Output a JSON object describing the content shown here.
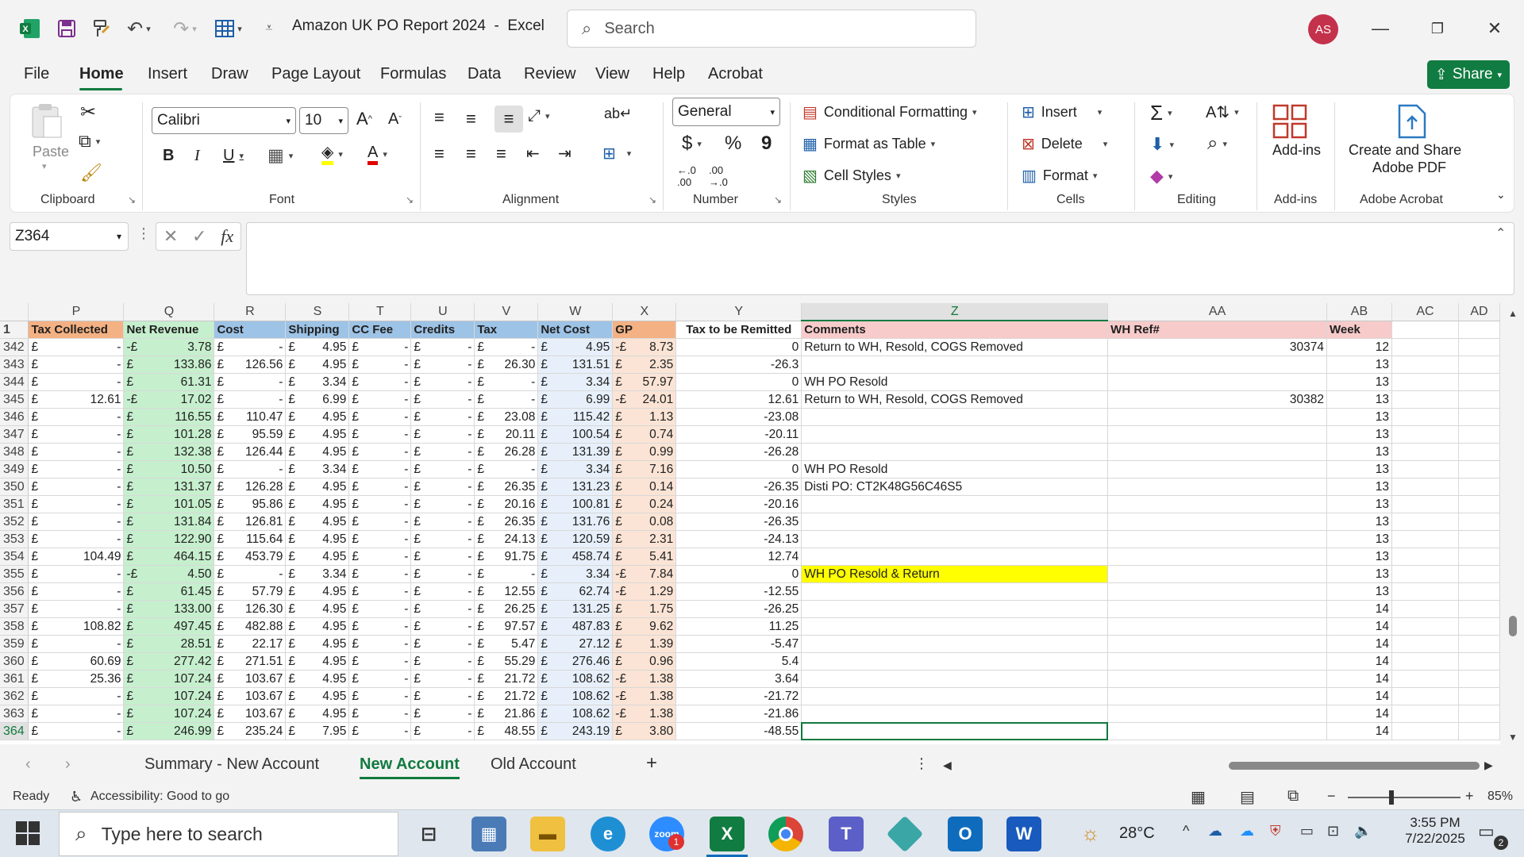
{
  "app": {
    "title": "Amazon UK PO Report 2024",
    "app_name": "Excel",
    "separator": "-",
    "user_initials": "AS"
  },
  "search": {
    "placeholder": "Search"
  },
  "menu": {
    "tabs": [
      "File",
      "Home",
      "Insert",
      "Draw",
      "Page Layout",
      "Formulas",
      "Data",
      "Review",
      "View",
      "Help",
      "Acrobat"
    ],
    "active": "Home",
    "share_label": "Share"
  },
  "ribbon": {
    "clipboard": {
      "label": "Clipboard",
      "paste": "Paste"
    },
    "font": {
      "label": "Font",
      "name": "Calibri",
      "size": "10"
    },
    "alignment": {
      "label": "Alignment"
    },
    "number": {
      "label": "Number",
      "format": "General",
      "currency": "$",
      "percent": "%",
      "comma": "9"
    },
    "styles": {
      "label": "Styles",
      "conditional": "Conditional Formatting",
      "table": "Format as Table",
      "cell": "Cell Styles"
    },
    "cells": {
      "label": "Cells",
      "insert": "Insert",
      "delete": "Delete",
      "format": "Format"
    },
    "editing": {
      "label": "Editing"
    },
    "addins": {
      "label": "Add-ins",
      "button": "Add-ins"
    },
    "acrobat": {
      "label": "Adobe Acrobat",
      "line1": "Create and Share",
      "line2": "Adobe PDF"
    }
  },
  "formula_bar": {
    "name_box": "Z364",
    "fx": "fx",
    "value": ""
  },
  "colors": {
    "accent": "#107c41",
    "header_orange": "#f4b183",
    "green": "#c6efce",
    "blue": "#9dc3e6",
    "pink": "#f8cbcb",
    "highlight": "#ffff00"
  },
  "columns": [
    "P",
    "Q",
    "R",
    "S",
    "T",
    "U",
    "V",
    "W",
    "X",
    "Y",
    "Z",
    "AA",
    "AB",
    "AC",
    "AD"
  ],
  "selected_column": "Z",
  "header_row_num": "1",
  "headers": [
    "Tax Collected",
    "Net Revenue",
    "Cost",
    "Shipping",
    "CC Fee",
    "Credits",
    "Tax",
    "Net Cost",
    "GP",
    "Tax to be Remitted",
    "Comments",
    "WH Ref#",
    "Week",
    "",
    ""
  ],
  "currency_symbol": "£",
  "rows": [
    {
      "n": "342",
      "p": "-",
      "qs": "-£",
      "q": "3.78",
      "r": "-",
      "s": "4.95",
      "t": "-",
      "u": "-",
      "v": "-",
      "w": "4.95",
      "xs": "-£",
      "x": "8.73",
      "y": "0",
      "z": "Return to WH, Resold, COGS Removed",
      "aa": "30374",
      "ab": "12"
    },
    {
      "n": "343",
      "p": "-",
      "qs": "£",
      "q": "133.86",
      "r": "126.56",
      "s": "4.95",
      "t": "-",
      "u": "-",
      "v": "26.30",
      "w": "131.51",
      "xs": "£",
      "x": "2.35",
      "y": "-26.3",
      "z": "",
      "aa": "",
      "ab": "13"
    },
    {
      "n": "344",
      "p": "-",
      "qs": "£",
      "q": "61.31",
      "r": "-",
      "s": "3.34",
      "t": "-",
      "u": "-",
      "v": "-",
      "w": "3.34",
      "xs": "£",
      "x": "57.97",
      "y": "0",
      "z": "WH PO Resold",
      "aa": "",
      "ab": "13"
    },
    {
      "n": "345",
      "p": "12.61",
      "qs": "-£",
      "q": "17.02",
      "r": "-",
      "s": "6.99",
      "t": "-",
      "u": "-",
      "v": "-",
      "w": "6.99",
      "xs": "-£",
      "x": "24.01",
      "y": "12.61",
      "z": "Return to WH, Resold, COGS Removed",
      "aa": "30382",
      "ab": "13"
    },
    {
      "n": "346",
      "p": "-",
      "qs": "£",
      "q": "116.55",
      "r": "110.47",
      "s": "4.95",
      "t": "-",
      "u": "-",
      "v": "23.08",
      "w": "115.42",
      "xs": "£",
      "x": "1.13",
      "y": "-23.08",
      "z": "",
      "aa": "",
      "ab": "13"
    },
    {
      "n": "347",
      "p": "-",
      "qs": "£",
      "q": "101.28",
      "r": "95.59",
      "s": "4.95",
      "t": "-",
      "u": "-",
      "v": "20.11",
      "w": "100.54",
      "xs": "£",
      "x": "0.74",
      "y": "-20.11",
      "z": "",
      "aa": "",
      "ab": "13"
    },
    {
      "n": "348",
      "p": "-",
      "qs": "£",
      "q": "132.38",
      "r": "126.44",
      "s": "4.95",
      "t": "-",
      "u": "-",
      "v": "26.28",
      "w": "131.39",
      "xs": "£",
      "x": "0.99",
      "y": "-26.28",
      "z": "",
      "aa": "",
      "ab": "13"
    },
    {
      "n": "349",
      "p": "-",
      "qs": "£",
      "q": "10.50",
      "r": "-",
      "s": "3.34",
      "t": "-",
      "u": "-",
      "v": "-",
      "w": "3.34",
      "xs": "£",
      "x": "7.16",
      "y": "0",
      "z": "WH PO Resold",
      "aa": "",
      "ab": "13"
    },
    {
      "n": "350",
      "p": "-",
      "qs": "£",
      "q": "131.37",
      "r": "126.28",
      "s": "4.95",
      "t": "-",
      "u": "-",
      "v": "26.35",
      "w": "131.23",
      "xs": "£",
      "x": "0.14",
      "y": "-26.35",
      "z": "Disti PO: CT2K48G56C46S5",
      "aa": "",
      "ab": "13"
    },
    {
      "n": "351",
      "p": "-",
      "qs": "£",
      "q": "101.05",
      "r": "95.86",
      "s": "4.95",
      "t": "-",
      "u": "-",
      "v": "20.16",
      "w": "100.81",
      "xs": "£",
      "x": "0.24",
      "y": "-20.16",
      "z": "",
      "aa": "",
      "ab": "13"
    },
    {
      "n": "352",
      "p": "-",
      "qs": "£",
      "q": "131.84",
      "r": "126.81",
      "s": "4.95",
      "t": "-",
      "u": "-",
      "v": "26.35",
      "w": "131.76",
      "xs": "£",
      "x": "0.08",
      "y": "-26.35",
      "z": "",
      "aa": "",
      "ab": "13"
    },
    {
      "n": "353",
      "p": "-",
      "qs": "£",
      "q": "122.90",
      "r": "115.64",
      "s": "4.95",
      "t": "-",
      "u": "-",
      "v": "24.13",
      "w": "120.59",
      "xs": "£",
      "x": "2.31",
      "y": "-24.13",
      "z": "",
      "aa": "",
      "ab": "13"
    },
    {
      "n": "354",
      "p": "104.49",
      "qs": "£",
      "q": "464.15",
      "r": "453.79",
      "s": "4.95",
      "t": "-",
      "u": "-",
      "v": "91.75",
      "w": "458.74",
      "xs": "£",
      "x": "5.41",
      "y": "12.74",
      "z": "",
      "aa": "",
      "ab": "13"
    },
    {
      "n": "355",
      "p": "-",
      "qs": "-£",
      "q": "4.50",
      "r": "-",
      "s": "3.34",
      "t": "-",
      "u": "-",
      "v": "-",
      "w": "3.34",
      "xs": "-£",
      "x": "7.84",
      "y": "0",
      "z": "WH PO Resold & Return",
      "aa": "",
      "ab": "13",
      "hl": true
    },
    {
      "n": "356",
      "p": "-",
      "qs": "£",
      "q": "61.45",
      "r": "57.79",
      "s": "4.95",
      "t": "-",
      "u": "-",
      "v": "12.55",
      "w": "62.74",
      "xs": "-£",
      "x": "1.29",
      "y": "-12.55",
      "z": "",
      "aa": "",
      "ab": "13"
    },
    {
      "n": "357",
      "p": "-",
      "qs": "£",
      "q": "133.00",
      "r": "126.30",
      "s": "4.95",
      "t": "-",
      "u": "-",
      "v": "26.25",
      "w": "131.25",
      "xs": "£",
      "x": "1.75",
      "y": "-26.25",
      "z": "",
      "aa": "",
      "ab": "14"
    },
    {
      "n": "358",
      "p": "108.82",
      "qs": "£",
      "q": "497.45",
      "r": "482.88",
      "s": "4.95",
      "t": "-",
      "u": "-",
      "v": "97.57",
      "w": "487.83",
      "xs": "£",
      "x": "9.62",
      "y": "11.25",
      "z": "",
      "aa": "",
      "ab": "14"
    },
    {
      "n": "359",
      "p": "-",
      "qs": "£",
      "q": "28.51",
      "r": "22.17",
      "s": "4.95",
      "t": "-",
      "u": "-",
      "v": "5.47",
      "w": "27.12",
      "xs": "£",
      "x": "1.39",
      "y": "-5.47",
      "z": "",
      "aa": "",
      "ab": "14"
    },
    {
      "n": "360",
      "p": "60.69",
      "qs": "£",
      "q": "277.42",
      "r": "271.51",
      "s": "4.95",
      "t": "-",
      "u": "-",
      "v": "55.29",
      "w": "276.46",
      "xs": "£",
      "x": "0.96",
      "y": "5.4",
      "z": "",
      "aa": "",
      "ab": "14"
    },
    {
      "n": "361",
      "p": "25.36",
      "qs": "£",
      "q": "107.24",
      "r": "103.67",
      "s": "4.95",
      "t": "-",
      "u": "-",
      "v": "21.72",
      "w": "108.62",
      "xs": "-£",
      "x": "1.38",
      "y": "3.64",
      "z": "",
      "aa": "",
      "ab": "14"
    },
    {
      "n": "362",
      "p": "-",
      "qs": "£",
      "q": "107.24",
      "r": "103.67",
      "s": "4.95",
      "t": "-",
      "u": "-",
      "v": "21.72",
      "w": "108.62",
      "xs": "-£",
      "x": "1.38",
      "y": "-21.72",
      "z": "",
      "aa": "",
      "ab": "14"
    },
    {
      "n": "363",
      "p": "-",
      "qs": "£",
      "q": "107.24",
      "r": "103.67",
      "s": "4.95",
      "t": "-",
      "u": "-",
      "v": "21.86",
      "w": "108.62",
      "xs": "-£",
      "x": "1.38",
      "y": "-21.86",
      "z": "",
      "aa": "",
      "ab": "14"
    },
    {
      "n": "364",
      "p": "-",
      "qs": "£",
      "q": "246.99",
      "r": "235.24",
      "s": "7.95",
      "t": "-",
      "u": "-",
      "v": "48.55",
      "w": "243.19",
      "xs": "£",
      "x": "3.80",
      "y": "-48.55",
      "z": "",
      "aa": "",
      "ab": "14"
    }
  ],
  "sheets": {
    "tabs": [
      "Summary - New Account",
      "New Account",
      "Old Account"
    ],
    "active": "New Account",
    "add": "+"
  },
  "status": {
    "ready": "Ready",
    "accessibility": "Accessibility: Good to go",
    "zoom": "85%"
  },
  "taskbar": {
    "search_placeholder": "Type here to search",
    "weather": "28°C",
    "time": "3:55 PM",
    "date": "7/22/2025",
    "notif_count": "2",
    "zoom_badge": "1"
  }
}
